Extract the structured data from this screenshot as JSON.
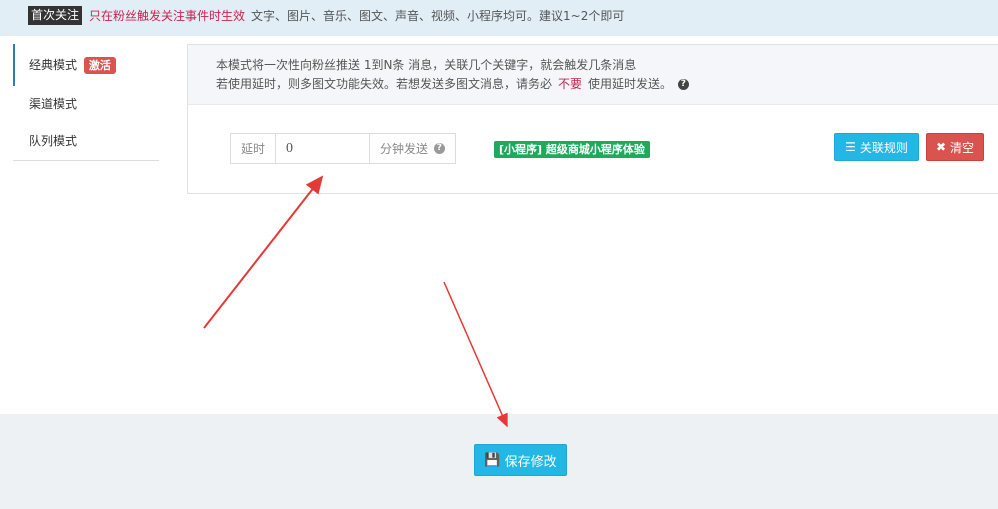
{
  "notice": {
    "tag": "首次关注",
    "warning": "只在粉丝触发关注事件时生效",
    "text": "文字、图片、音乐、图文、声音、视频、小程序均可。建议1~2个即可"
  },
  "sidebar": {
    "items": [
      {
        "label": "经典模式",
        "badge": "激活"
      },
      {
        "label": "渠道模式"
      },
      {
        "label": "队列模式"
      }
    ]
  },
  "panel": {
    "desc_line1": "本模式将一次性向粉丝推送 1到N条 消息，关联几个关键字，就会触发几条消息",
    "desc_line2_a": "若使用延时，则多图文功能失效。若想发送多图文消息，请务必",
    "desc_no": "不要",
    "desc_line2_b": "使用延时发送。",
    "delay_prefix": "延时",
    "delay_value": "0",
    "delay_suffix": "分钟发送",
    "miniapp_label": "[小程序] 超级商城小程序体验",
    "link_rule_label": "关联规则",
    "clear_label": "清空"
  },
  "footer": {
    "save_label": "保存修改"
  },
  "colors": {
    "accent": "#23b7e5",
    "danger": "#d9534f",
    "success": "#1fa95b",
    "arrow": "#e53935"
  }
}
